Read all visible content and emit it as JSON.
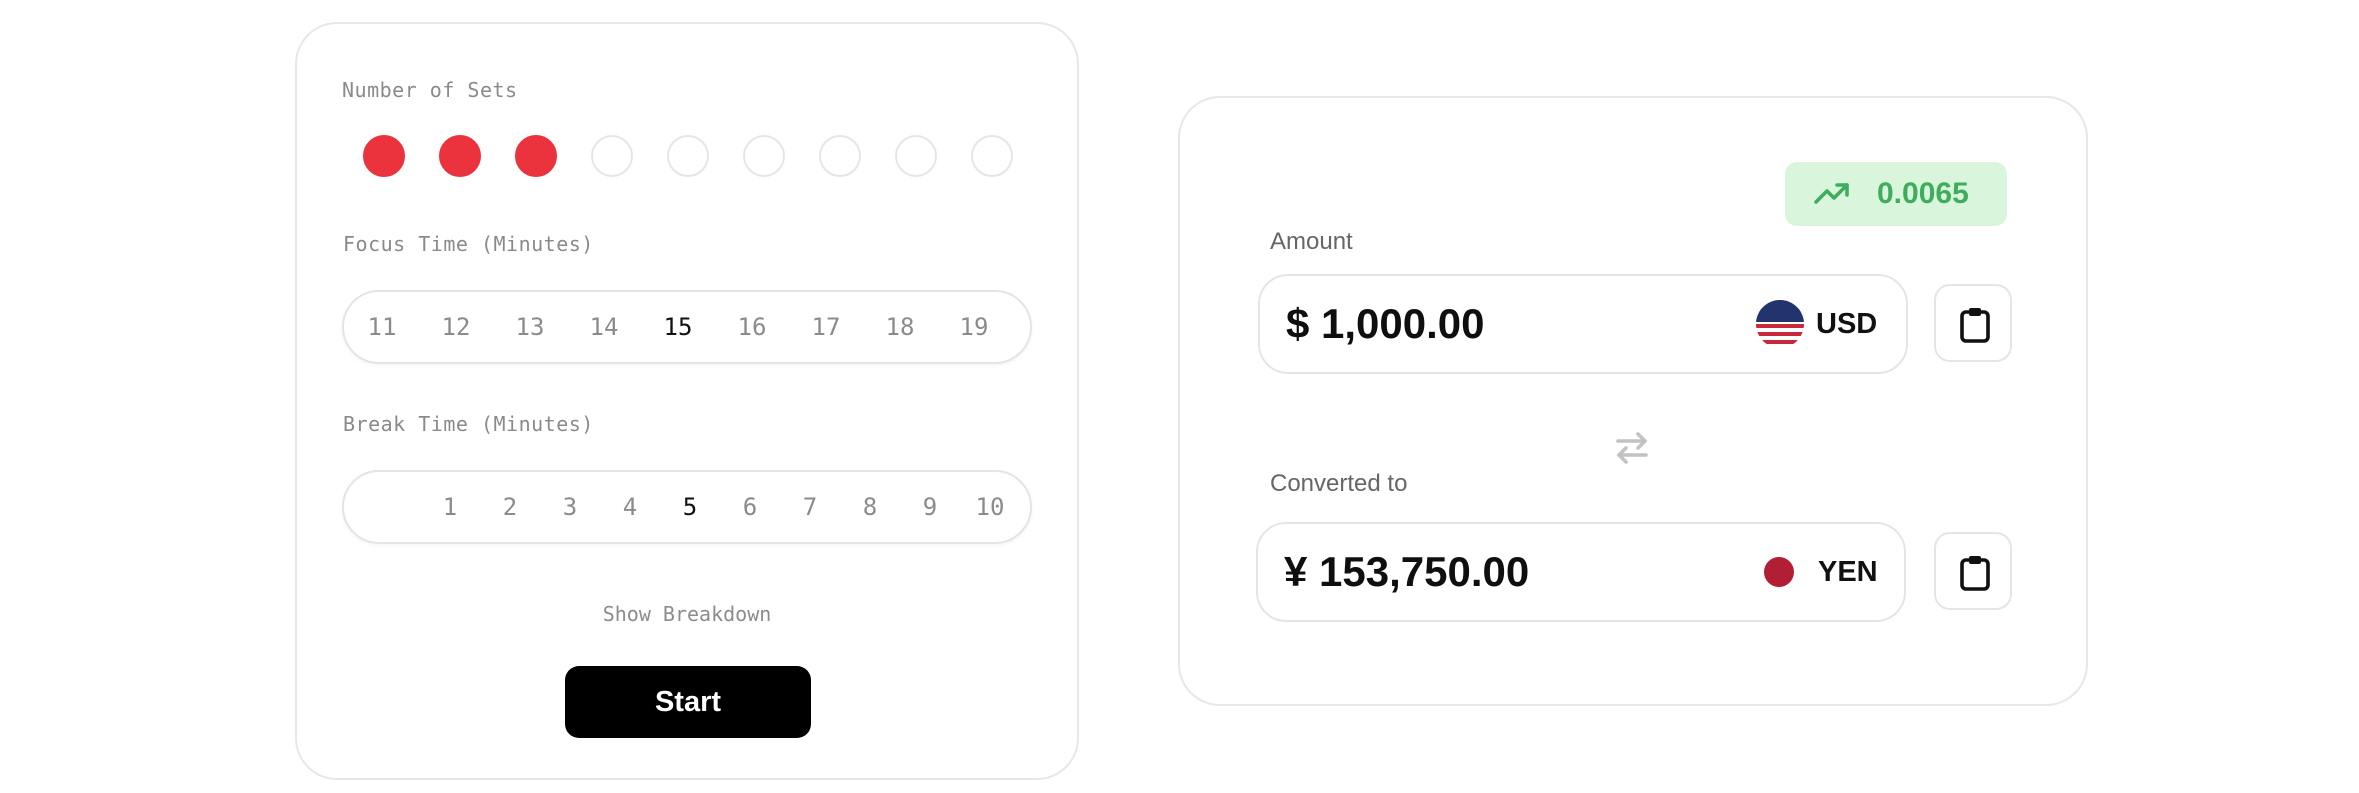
{
  "pomodoro": {
    "sets_label": "Number of Sets",
    "sets_total": 9,
    "sets_selected": 3,
    "focus_label": "Focus Time (Minutes)",
    "focus_options": [
      "11",
      "12",
      "13",
      "14",
      "15",
      "16",
      "17",
      "18",
      "19"
    ],
    "focus_selected": "15",
    "break_label": "Break Time (Minutes)",
    "break_options": [
      "1",
      "2",
      "3",
      "4",
      "5",
      "6",
      "7",
      "8",
      "9",
      "10"
    ],
    "break_selected": "5",
    "breakdown_label": "Show Breakdown",
    "start_label": "Start"
  },
  "converter": {
    "rate": "0.0065",
    "rate_icon": "trending-up-icon",
    "amount_label": "Amount",
    "amount_value": "$ 1,000.00",
    "amount_currency": "USD",
    "converted_label": "Converted to",
    "converted_value": "¥ 153,750.00",
    "converted_currency": "YEN"
  },
  "colors": {
    "set_filled": "#ea333d",
    "rate_bg": "#d9f6dc",
    "rate_text": "#3fad5d",
    "start_bg": "#000000"
  }
}
